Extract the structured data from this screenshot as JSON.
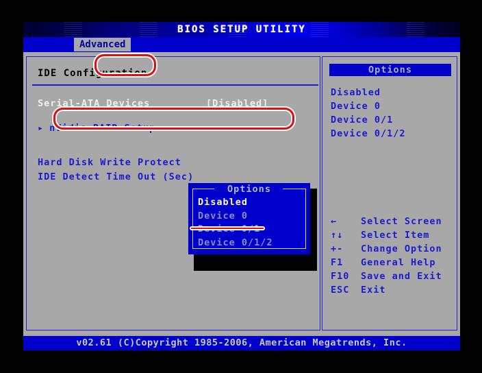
{
  "window": {
    "title": "BIOS SETUP UTILITY"
  },
  "menubar": {
    "tabs": [
      {
        "label": "Advanced",
        "active": true
      }
    ]
  },
  "main": {
    "section_title": "IDE Configuration",
    "settings": [
      {
        "label": "Serial-ATA Devices",
        "value": "[Disabled]",
        "state": "selected-dimmed"
      },
      {
        "label": "nVidia RAID Setup",
        "arrow": "▸",
        "type": "submenu"
      },
      {
        "label": "Hard Disk Write Protect",
        "type": "plain"
      },
      {
        "label": "IDE Detect Time Out (Sec)",
        "type": "plain"
      }
    ]
  },
  "popup": {
    "title": "Options",
    "items": [
      {
        "label": "Disabled",
        "selected": true
      },
      {
        "label": "Device 0",
        "selected": false
      },
      {
        "label": "Device 0/1",
        "selected": false,
        "annotated": true
      },
      {
        "label": "Device 0/1/2",
        "selected": false
      }
    ]
  },
  "options_panel": {
    "header": "Options",
    "items": [
      {
        "label": "Disabled"
      },
      {
        "label": "Device 0"
      },
      {
        "label": "Device 0/1"
      },
      {
        "label": "Device 0/1/2"
      }
    ]
  },
  "help_keys": [
    {
      "key": "←",
      "desc": "Select Screen"
    },
    {
      "key": "↑↓",
      "desc": "Select Item"
    },
    {
      "key": "+-",
      "desc": "Change Option"
    },
    {
      "key": "F1",
      "desc": "General Help"
    },
    {
      "key": "F10",
      "desc": "Save and Exit"
    },
    {
      "key": "ESC",
      "desc": "Exit"
    }
  ],
  "footer": {
    "copyright": "v02.61 (C)Copyright 1985-2006, American Megatrends, Inc."
  },
  "colors": {
    "background_gray": "#a8a8a8",
    "bios_blue": "#0000cc",
    "text_blue": "#1a1ad0",
    "annotation_red": "#e01010",
    "selected_white": "#ffffff"
  }
}
